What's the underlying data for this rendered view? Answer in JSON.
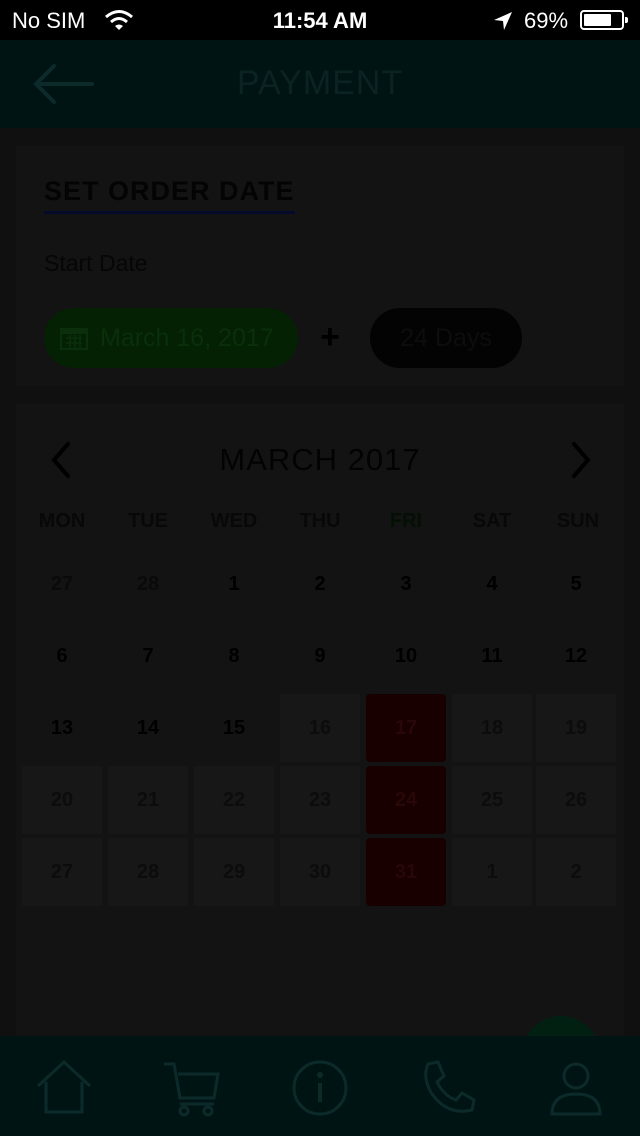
{
  "status_bar": {
    "carrier": "No SIM",
    "time": "11:54 AM",
    "battery": "69%"
  },
  "nav": {
    "title": "PAYMENT",
    "back_icon": "back-arrow-icon"
  },
  "order": {
    "section_title": "SET ORDER DATE",
    "start_label": "Start Date",
    "start_date": "March 16, 2017",
    "plus": "+",
    "duration": "24 Days"
  },
  "calendar": {
    "month_title": "MARCH 2017",
    "weekdays": [
      "MON",
      "TUE",
      "WED",
      "THU",
      "FRI",
      "SAT",
      "SUN"
    ],
    "weeks": [
      [
        "27",
        "28",
        "1",
        "2",
        "3",
        "4",
        "5"
      ],
      [
        "6",
        "7",
        "8",
        "9",
        "10",
        "11",
        "12"
      ],
      [
        "13",
        "14",
        "15",
        "16",
        "17",
        "18",
        "19"
      ],
      [
        "20",
        "21",
        "22",
        "23",
        "24",
        "25",
        "26"
      ],
      [
        "27",
        "28",
        "29",
        "30",
        "31",
        "1",
        "2"
      ]
    ],
    "selected_days": [
      "17",
      "24",
      "31"
    ]
  },
  "tabs": [
    {
      "icon": "home-icon"
    },
    {
      "icon": "cart-icon"
    },
    {
      "icon": "info-icon"
    },
    {
      "icon": "phone-icon"
    },
    {
      "icon": "profile-icon"
    }
  ],
  "colors": {
    "nav_bg": "#011414",
    "selected_day": "#180000",
    "date_pill": "#042104"
  }
}
